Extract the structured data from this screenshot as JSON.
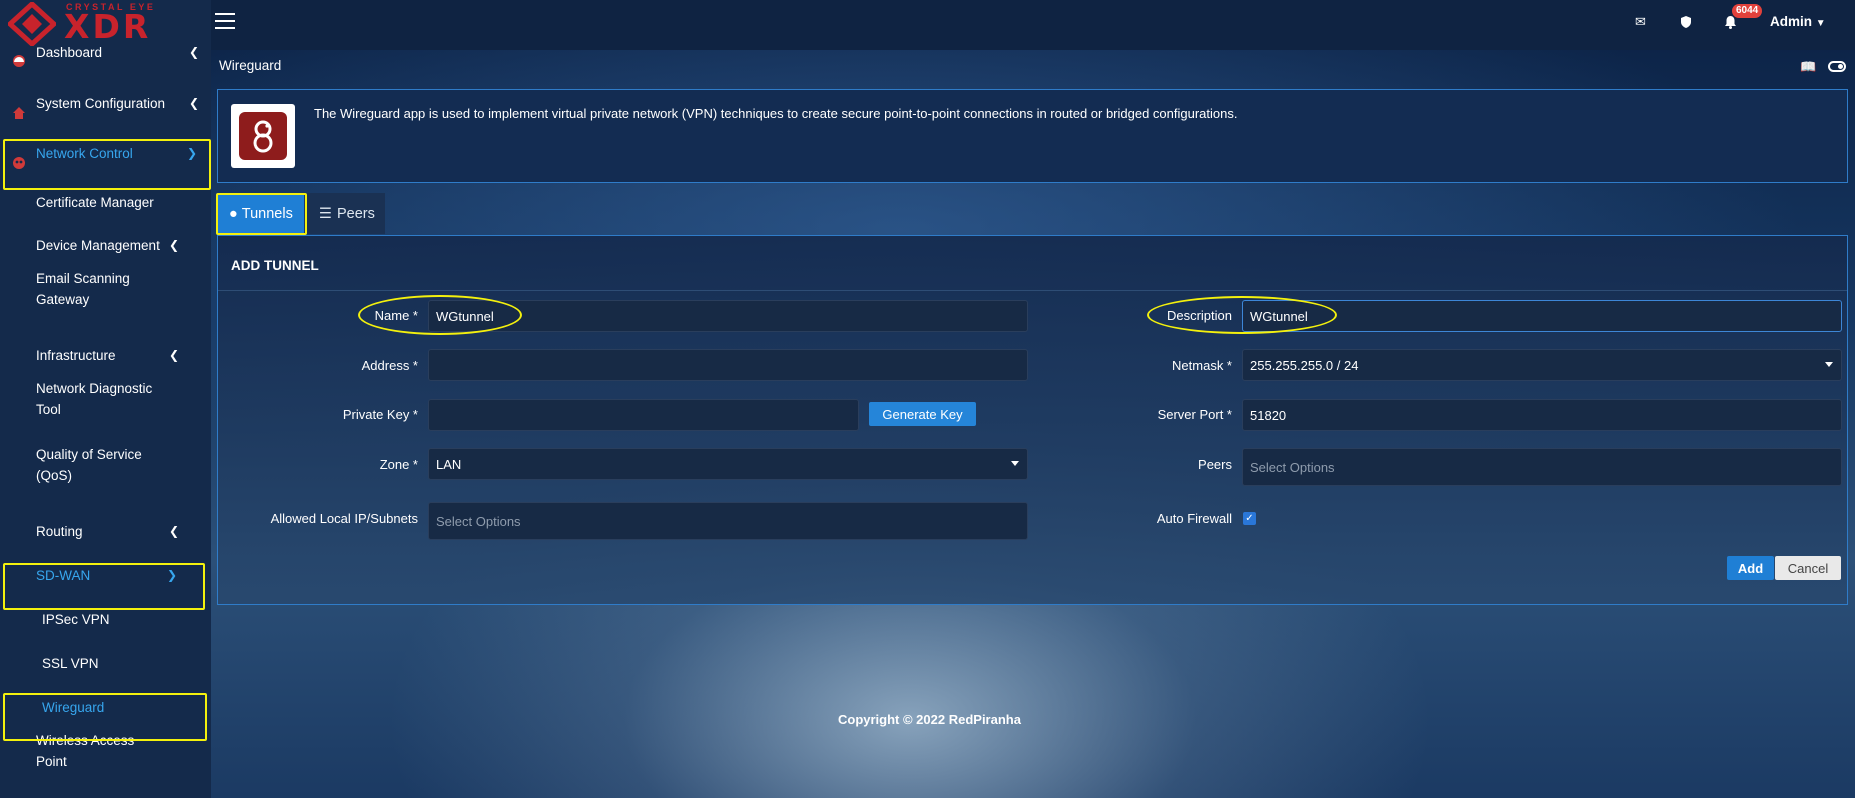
{
  "brand": {
    "tagline": "CRYSTAL EYE",
    "name": "XDR"
  },
  "topbar": {
    "notification_count": "6044",
    "user_label": "Admin"
  },
  "sidebar": {
    "items": [
      {
        "label": "Dashboard"
      },
      {
        "label": "System Configuration"
      },
      {
        "label": "Network Control"
      },
      {
        "label": "Certificate Manager"
      },
      {
        "label": "Device Management"
      },
      {
        "label": "Email Scanning Gateway"
      },
      {
        "label": "Infrastructure"
      },
      {
        "label": "Network Diagnostic Tool"
      },
      {
        "label": "Quality of Service (QoS)"
      },
      {
        "label": "Routing"
      },
      {
        "label": "SD-WAN"
      },
      {
        "label": "IPSec VPN"
      },
      {
        "label": "SSL VPN"
      },
      {
        "label": "Wireguard"
      },
      {
        "label": "Wireless Access Point"
      }
    ]
  },
  "page": {
    "title": "Wireguard",
    "description": "The Wireguard app is used to implement virtual private network (VPN) techniques to create secure point-to-point connections in routed or bridged configurations.",
    "tabs": [
      {
        "label": "Tunnels"
      },
      {
        "label": "Peers"
      }
    ]
  },
  "form": {
    "title": "ADD TUNNEL",
    "name": {
      "label": "Name *",
      "value": "WGtunnel"
    },
    "address": {
      "label": "Address *",
      "value": ""
    },
    "private_key": {
      "label": "Private Key *",
      "value": "",
      "button": "Generate Key"
    },
    "zone": {
      "label": "Zone *",
      "value": "LAN"
    },
    "allowed_local": {
      "label": "Allowed Local IP/Subnets",
      "placeholder": "Select Options"
    },
    "description": {
      "label": "Description",
      "value": "WGtunnel"
    },
    "netmask": {
      "label": "Netmask *",
      "value": "255.255.255.0 / 24"
    },
    "server_port": {
      "label": "Server Port *",
      "value": "51820"
    },
    "peers": {
      "label": "Peers",
      "placeholder": "Select Options"
    },
    "auto_firewall": {
      "label": "Auto Firewall",
      "checked": true
    },
    "add_label": "Add",
    "cancel_label": "Cancel"
  },
  "footer": {
    "copyright": "Copyright © 2022 RedPiranha"
  },
  "colors": {
    "accent": "#1f7fd5",
    "highlight": "#f4f10d",
    "brand": "#c8232c"
  }
}
